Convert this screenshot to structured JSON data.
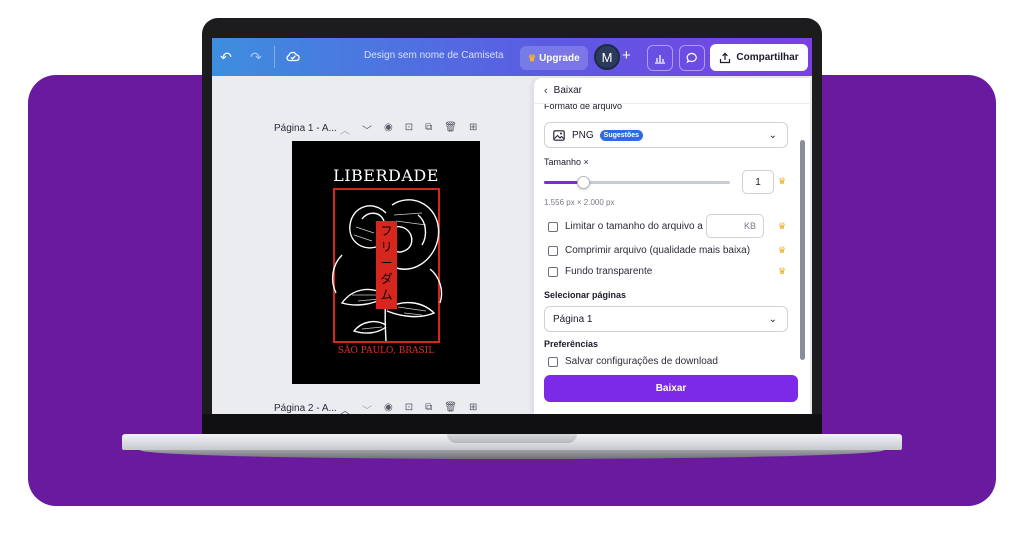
{
  "topbar": {
    "doc_title": "Design sem nome de Camiseta",
    "upgrade_label": "Upgrade",
    "avatar_initial": "M",
    "share_label": "Compartilhar"
  },
  "canvas": {
    "page1_label": "Página 1 - A...",
    "page2_label": "Página 2 - A...",
    "design": {
      "title": "LIBERDADE",
      "kanji": [
        "フ",
        "リ",
        "ー",
        "ダ",
        "ム"
      ],
      "subtitle": "SÃO PAULO, BRASIL"
    }
  },
  "panel": {
    "header": "Baixar",
    "file_format_label": "Formato de arquivo",
    "file_format_value": "PNG",
    "file_format_badge": "Sugestões",
    "size_label": "Tamanho ×",
    "size_value": "1",
    "size_slider_fraction": 0.21,
    "dimensions": "1.556 px × 2.000 px",
    "limit_size_label": "Limitar o tamanho do arquivo a",
    "kb_unit": "KB",
    "compress_label": "Comprimir arquivo (qualidade mais baixa)",
    "transparent_label": "Fundo transparente",
    "select_pages_label": "Selecionar páginas",
    "select_pages_value": "Página 1",
    "preferences_label": "Preferências",
    "save_settings_label": "Salvar configurações de download",
    "download_button": "Baixar"
  },
  "colors": {
    "accent": "#7d2ae8",
    "background_purple": "#6a1a9e",
    "badge_blue": "#2d6ae3",
    "crown_gold": "#f0a81c",
    "design_red": "#d7261e"
  }
}
